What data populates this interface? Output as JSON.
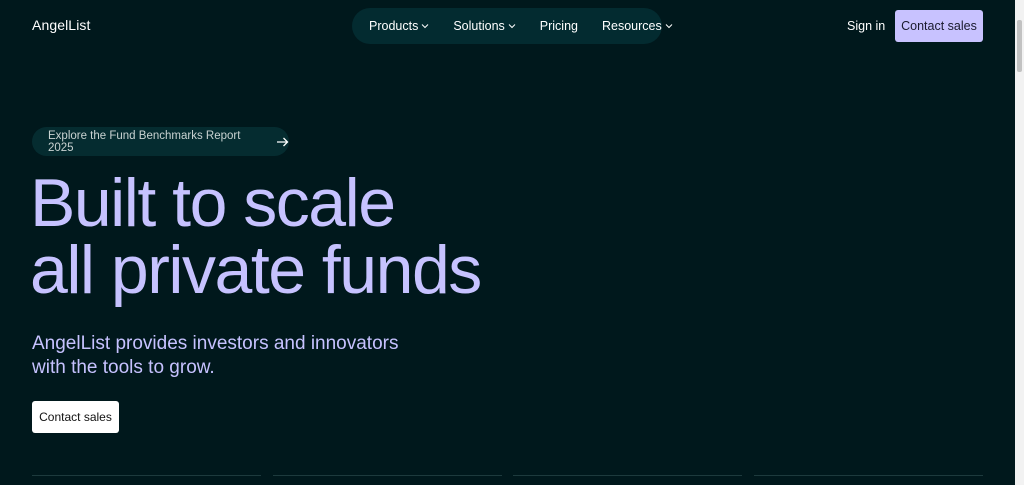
{
  "brand": {
    "name": "AngelList"
  },
  "nav": {
    "items": [
      {
        "label": "Products",
        "has_menu": true
      },
      {
        "label": "Solutions",
        "has_menu": true
      },
      {
        "label": "Pricing",
        "has_menu": false
      },
      {
        "label": "Resources",
        "has_menu": true
      }
    ]
  },
  "header": {
    "signin_label": "Sign in",
    "contact_label": "Contact sales"
  },
  "announcement": {
    "label": "Explore the Fund Benchmarks Report 2025",
    "icon": "arrow-right-icon"
  },
  "hero": {
    "title_line1": "Built to scale",
    "title_line2": "all private funds",
    "subtitle_line1": "AngelList provides investors and innovators",
    "subtitle_line2": "with the tools to grow.",
    "cta_label": "Contact sales"
  },
  "colors": {
    "background": "#00181c",
    "accent": "#c6c2ff",
    "nav_pill": "#032b30"
  }
}
